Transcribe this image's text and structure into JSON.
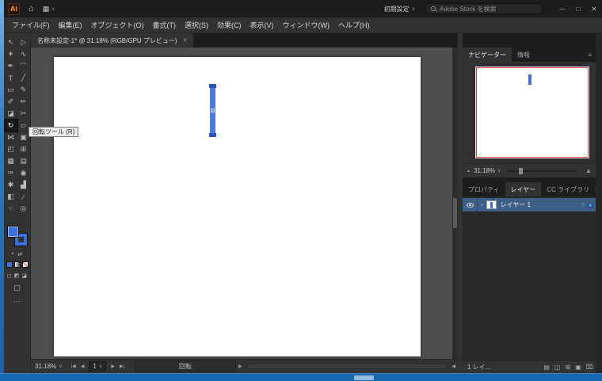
{
  "colors": {
    "accent_blue": "#3a72e0",
    "selection_blue": "#4b79e8",
    "proxy_red": "#e03c3c",
    "layer_row_blue": "#3b5f86",
    "taskbar_blue": "#1766b0"
  },
  "titlebar": {
    "logo": "Ai",
    "home_glyph": "⌂",
    "arrange_glyph": "▦",
    "chevron": "∨",
    "workspace": "初期設定",
    "search_placeholder": "Adobe Stock を検索",
    "minimize": "─",
    "maximize": "□",
    "close": "✕"
  },
  "menubar": {
    "items": [
      "ファイル(F)",
      "編集(E)",
      "オブジェクト(O)",
      "書式(T)",
      "選択(S)",
      "効果(C)",
      "表示(V)",
      "ウィンドウ(W)",
      "ヘルプ(H)"
    ]
  },
  "toolbar": {
    "tools": [
      "↖",
      "▷",
      "✶",
      "∿",
      "✒",
      "⌒",
      "T",
      "╱",
      "▭",
      "✎",
      "✐",
      "✏",
      "◪",
      "✂",
      "↻",
      "▱",
      "⋈",
      "▣",
      "◰",
      "⊞",
      "▦",
      "▤",
      "✑",
      "◉",
      "✱",
      "▟",
      "◧",
      "∕",
      "☜",
      "◎"
    ],
    "default_colors_glyph": "▪",
    "swap_glyph": "⇄",
    "draw_modes": [
      "◻",
      "◩",
      "◪"
    ],
    "screen_mode_glyph": "▢",
    "edit_toolbar_glyph": "…"
  },
  "tooltip": {
    "text": "回転ツール (R)"
  },
  "document": {
    "tab_title": "名称未設定-1* @ 31.18% (RGB/GPU プレビュー)",
    "tab_close": "✕"
  },
  "statusbar": {
    "zoom": "31.18%",
    "chevron": "∨",
    "first": "|◀",
    "prev": "◀",
    "artboard": "1",
    "next": "▶",
    "last": "▶|",
    "tool": "回転",
    "scroll_left": "◀",
    "scroll_right": "▶"
  },
  "panels": {
    "navigator": {
      "tab_navigator": "ナビゲーター",
      "tab_info": "情報",
      "menu": "≡",
      "zoom_out": "▲",
      "zoom": "31.18%",
      "chevron": "∨",
      "zoom_in": "▲"
    },
    "layers": {
      "tab_properties": "プロパティ",
      "tab_layers": "レイヤー",
      "tab_cc": "CC ライブラリ",
      "menu": "≡",
      "chevron": "›",
      "name": "レイヤー 1",
      "target": "○",
      "count": "1 レイ...",
      "icons": [
        "▤",
        "◫",
        "⊞",
        "▣",
        "⌧"
      ]
    }
  }
}
